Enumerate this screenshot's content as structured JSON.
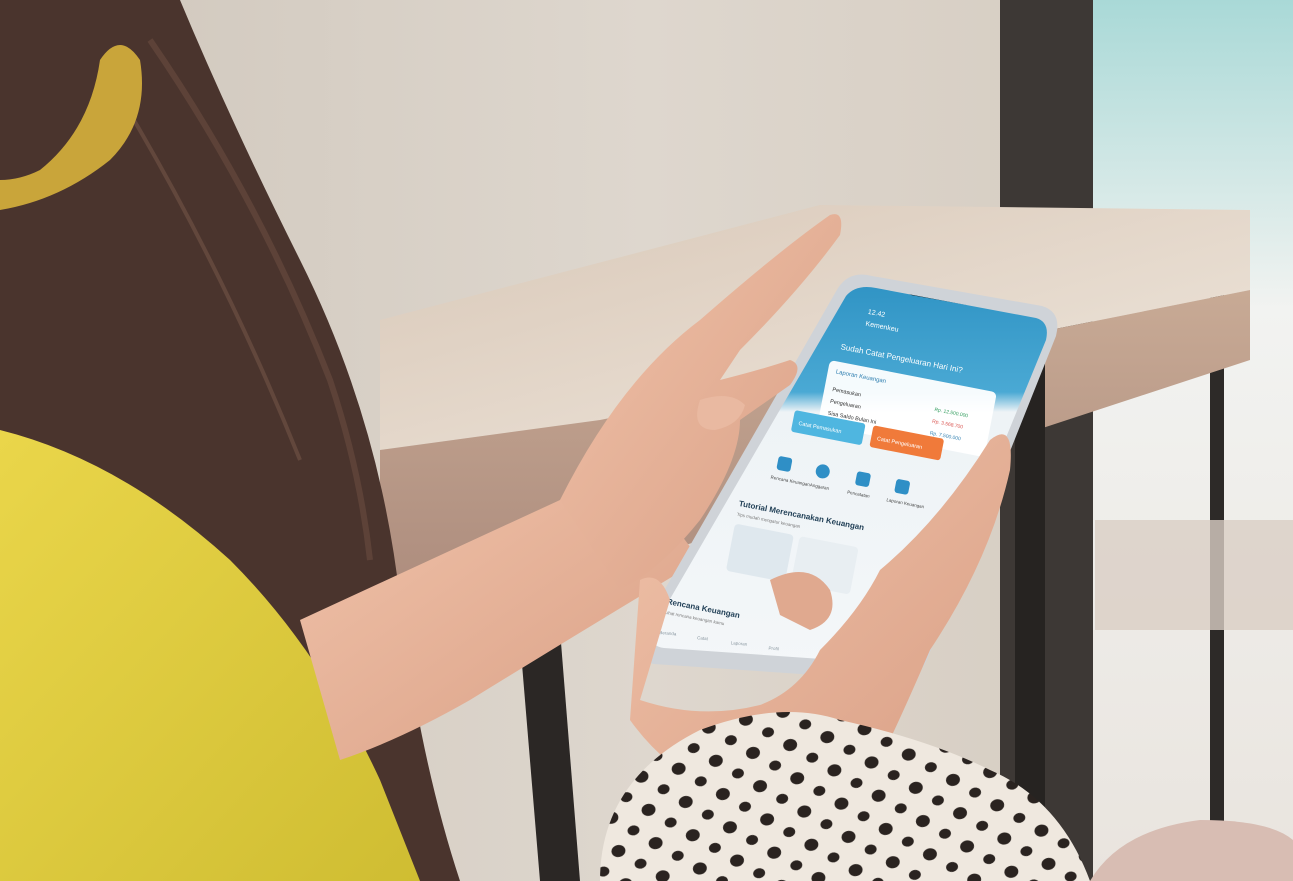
{
  "photo": {
    "colors": {
      "wall": "#d9d2c9",
      "counter_top": "#e4d8ca",
      "counter_front": "#b99883",
      "shirt": "#e3d244",
      "hair": "#4a342d",
      "skin": "#e8b69c",
      "phone_screen": "#3e9ccb",
      "phone_frame": "#d6d9de",
      "polka_fabric": "#eee6dc"
    }
  },
  "app": {
    "status_time": "12.42",
    "brand": "Kemenkeu",
    "greeting": "Sudah Catat Pengeluaran Hari Ini?",
    "report_card": {
      "title": "Laporan Keuangan",
      "rows": [
        {
          "label": "Pemasukan",
          "value": "Rp. 12.500.000"
        },
        {
          "label": "Pengeluaran",
          "value": "Rp. 3.568.700"
        },
        {
          "label": "Sisa Saldo Bulan Ini",
          "value": "Rp. 7.500.000"
        }
      ]
    },
    "action_buttons": [
      {
        "label": "Catat Pemasukan",
        "color": "#4fb6e0"
      },
      {
        "label": "Catat Pengeluaran",
        "color": "#f07a3a"
      }
    ],
    "menu_items": [
      {
        "label": "Rencana Keuangan",
        "icon": "document-icon"
      },
      {
        "label": "Anggaran",
        "icon": "pie-chart-icon"
      },
      {
        "label": "Pencatatan",
        "icon": "ledger-icon"
      },
      {
        "label": "Laporan Keuangan",
        "icon": "report-icon"
      }
    ],
    "section_tutorial": {
      "title": "Tutorial Merencanakan Keuangan",
      "subtitle": "Tips mudah mengatur keuangan"
    },
    "section_plan": {
      "title": "Rencana Keuangan",
      "subtitle": "Lihat rencana keuangan kamu"
    },
    "tabbar": [
      "Beranda",
      "Catat",
      "Laporan",
      "Profil"
    ]
  }
}
